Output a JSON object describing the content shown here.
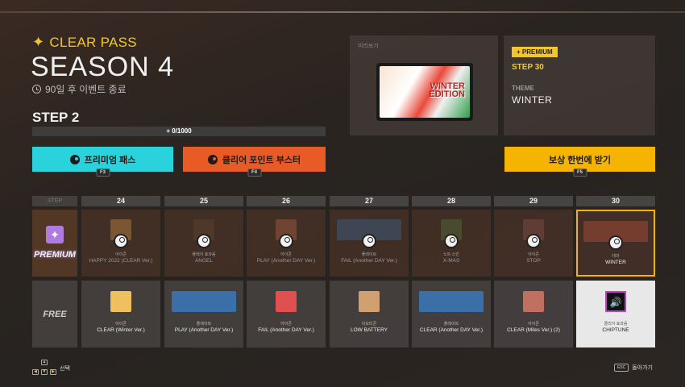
{
  "header": {
    "pass_title": "CLEAR PASS",
    "season": "SEASON 4",
    "remaining": "90일 후 이벤트 종료",
    "step_label": "STEP 2",
    "progress_text": "+ 0/1000",
    "progress_fraction": 0
  },
  "preview": {
    "label": "미리보기",
    "art_text_1": "WINTER",
    "art_text_2": "EDITION"
  },
  "info": {
    "tag": "+ PREMIUM",
    "step": "STEP 30",
    "theme_label": "THEME",
    "theme": "WINTER"
  },
  "buttons": {
    "premium": "프리미엄 패스",
    "premium_key": "F3",
    "booster": "클리어 포인트 부스터",
    "booster_key": "F4",
    "claim": "보상 한번에 받기",
    "claim_key": "F5"
  },
  "grid": {
    "step_header": "STEP",
    "columns": [
      "24",
      "25",
      "26",
      "27",
      "28",
      "29",
      "30"
    ],
    "premium_label": "PREMIUM",
    "free_label": "FREE",
    "premium_row": [
      {
        "sub": "아이콘",
        "label": "HAPPY 2022 (CLEAR Ver.)"
      },
      {
        "sub": "플레이 효과음",
        "label": "ANGEL"
      },
      {
        "sub": "아이콘",
        "label": "PLAY (Another DAY Ver.)"
      },
      {
        "sub": "플레이트",
        "label": "FAIL (Another DAY Ver.)"
      },
      {
        "sub": "노트 스킨",
        "label": "X-MAS"
      },
      {
        "sub": "아이콘",
        "label": "STOP"
      },
      {
        "sub": "테마",
        "label": "WINTER"
      }
    ],
    "free_row": [
      {
        "sub": "아이콘",
        "label": "CLEAR (Winter Ver.)"
      },
      {
        "sub": "플레이트",
        "label": "PLAY (Another DAY Ver.)"
      },
      {
        "sub": "아이콘",
        "label": "FAIL (Another DAY Ver.)"
      },
      {
        "sub": "이모티콘",
        "label": "LOW BATTERY"
      },
      {
        "sub": "플레이트",
        "label": "CLEAR (Another DAY Ver.)"
      },
      {
        "sub": "아이콘",
        "label": "CLEAR (Miles Ver.) (2)"
      },
      {
        "sub": "클리어 효과음",
        "label": "CHIPTUNE"
      }
    ]
  },
  "footer": {
    "select": "선택",
    "esc_key": "ESC",
    "back": "돌아가기"
  },
  "colors": {
    "accent": "#f4c62a",
    "premium_button": "#2ad3dc",
    "booster_button": "#e85a26",
    "claim_button": "#f4b400"
  }
}
